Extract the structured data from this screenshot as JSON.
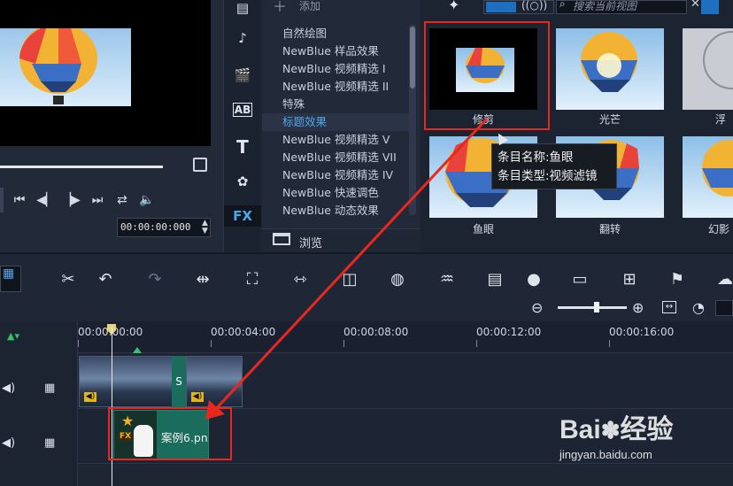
{
  "preview": {
    "timecode": "00:00:00:000"
  },
  "side_icons": [
    "FX",
    "T",
    "AB"
  ],
  "filter_list": {
    "add_label": "添加",
    "items": [
      "自然绘图",
      "NewBlue 样品效果",
      "NewBlue 视频精选 I",
      "NewBlue 视频精选 II",
      "特殊",
      "标题效果",
      "NewBlue 视频精选 V",
      "NewBlue 视频精选 VII",
      "NewBlue 视频精选 IV",
      "NewBlue 快速调色",
      "NewBlue 动态效果"
    ],
    "selected_index": 5,
    "browse_label": "浏览"
  },
  "gallery": {
    "search_placeholder": "搜索当前视图",
    "items": [
      {
        "label": "修剪"
      },
      {
        "label": "光芒"
      },
      {
        "label": "浮"
      },
      {
        "label": "鱼眼"
      },
      {
        "label": "翻转"
      },
      {
        "label": "幻影"
      }
    ]
  },
  "tooltip": {
    "name_line": "条目名称:鱼眼",
    "type_line": "条目类型:视频滤镜"
  },
  "ruler": {
    "labels": [
      "00:00:00:00",
      "00:00:04:00",
      "00:00:08:00",
      "00:00:12:00",
      "00:00:16:00"
    ]
  },
  "tracks": {
    "transition_label": "S",
    "overlay_clip_name": "案例6.pn",
    "fx_badge": "FX"
  },
  "watermark": {
    "brand": "Bai",
    "brand_cn": "经验",
    "url": "jingyan.baidu.com"
  },
  "colors": {
    "accent_blue": "#4fa6ea",
    "annotation_red": "#e8281f",
    "clip_green": "#1a6d5c"
  }
}
